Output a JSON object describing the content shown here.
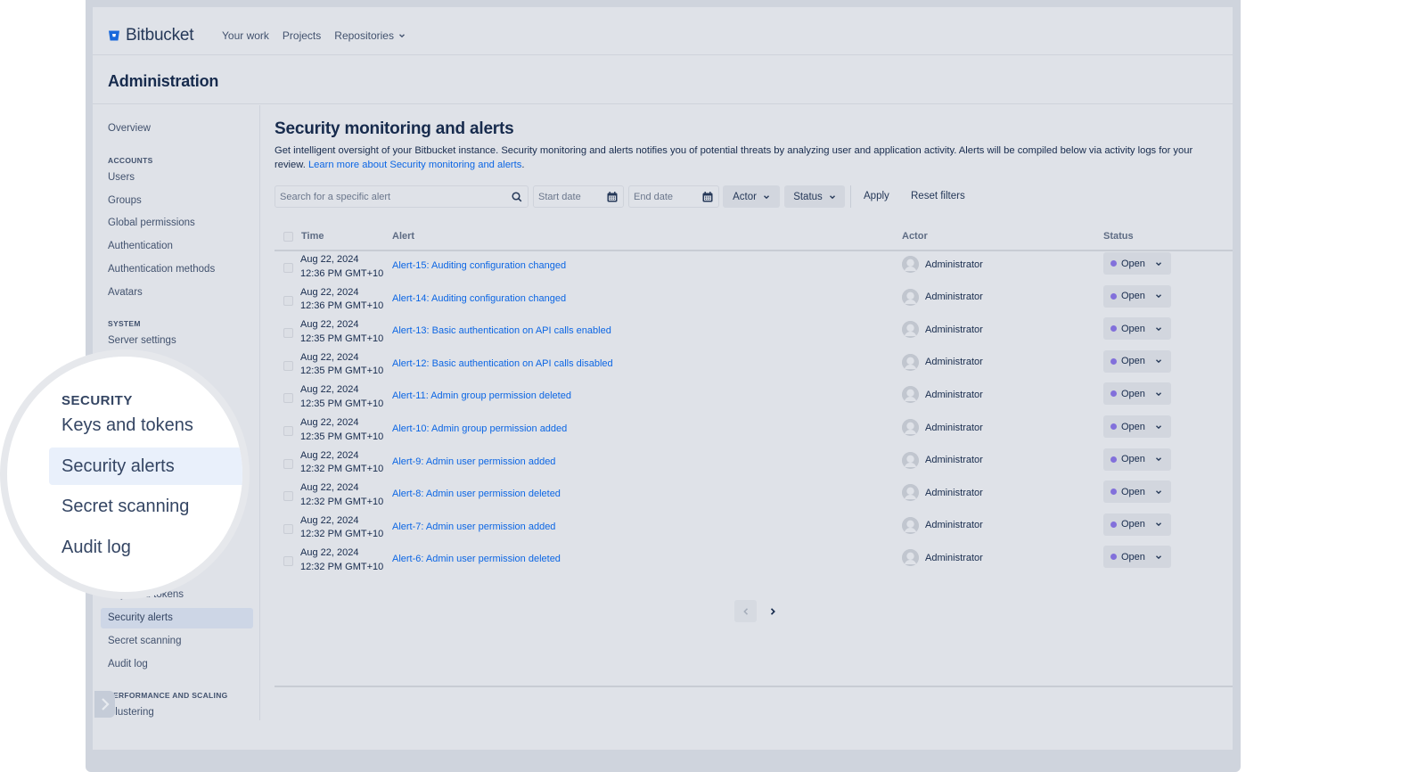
{
  "header": {
    "brand": "Bitbucket",
    "nav": [
      {
        "label": "Your work"
      },
      {
        "label": "Projects"
      },
      {
        "label": "Repositories",
        "has_dropdown": true
      }
    ]
  },
  "admin_title": "Administration",
  "sidebar": {
    "overview": "Overview",
    "sections": {
      "accounts": {
        "heading": "ACCOUNTS",
        "items": [
          "Users",
          "Groups",
          "Global permissions",
          "Authentication",
          "Authentication methods",
          "Avatars"
        ]
      },
      "system": {
        "heading": "SYSTEM",
        "items": [
          "Server settings"
        ]
      },
      "security": {
        "heading": "SECURITY",
        "items": [
          "Keys and tokens",
          "Security alerts",
          "Secret scanning",
          "Audit log"
        ],
        "active": "Security alerts"
      },
      "performance": {
        "heading": "PERFORMANCE AND SCALING",
        "items": [
          "Clustering"
        ]
      }
    }
  },
  "magnifier": {
    "heading": "SECURITY",
    "items": [
      "Keys and tokens",
      "Security alerts",
      "Secret scanning",
      "Audit log"
    ],
    "active": "Security alerts"
  },
  "page": {
    "title": "Security monitoring and alerts",
    "description": "Get intelligent oversight of your Bitbucket instance. Security monitoring and alerts notifies you of potential threats by analyzing user and application activity. Alerts will be compiled below via activity logs for your review.",
    "learn_more": "Learn more about Security monitoring and alerts",
    "learn_more_suffix": "."
  },
  "filters": {
    "search_placeholder": "Search for a specific alert",
    "search_value": "",
    "start_date_placeholder": "Start date",
    "end_date_placeholder": "End date",
    "actor_label": "Actor",
    "status_label": "Status",
    "apply_label": "Apply",
    "reset_label": "Reset filters"
  },
  "table": {
    "columns": {
      "time": "Time",
      "alert": "Alert",
      "actor": "Actor",
      "status": "Status"
    },
    "rows": [
      {
        "date": "Aug 22, 2024",
        "time": "12:36 PM GMT+10",
        "alert": "Alert-15: Auditing configuration changed",
        "actor": "Administrator",
        "status": "Open"
      },
      {
        "date": "Aug 22, 2024",
        "time": "12:36 PM GMT+10",
        "alert": "Alert-14: Auditing configuration changed",
        "actor": "Administrator",
        "status": "Open"
      },
      {
        "date": "Aug 22, 2024",
        "time": "12:35 PM GMT+10",
        "alert": "Alert-13: Basic authentication on API calls enabled",
        "actor": "Administrator",
        "status": "Open"
      },
      {
        "date": "Aug 22, 2024",
        "time": "12:35 PM GMT+10",
        "alert": "Alert-12: Basic authentication on API calls disabled",
        "actor": "Administrator",
        "status": "Open"
      },
      {
        "date": "Aug 22, 2024",
        "time": "12:35 PM GMT+10",
        "alert": "Alert-11: Admin group permission deleted",
        "actor": "Administrator",
        "status": "Open"
      },
      {
        "date": "Aug 22, 2024",
        "time": "12:35 PM GMT+10",
        "alert": "Alert-10: Admin group permission added",
        "actor": "Administrator",
        "status": "Open"
      },
      {
        "date": "Aug 22, 2024",
        "time": "12:32 PM GMT+10",
        "alert": "Alert-9: Admin user permission added",
        "actor": "Administrator",
        "status": "Open"
      },
      {
        "date": "Aug 22, 2024",
        "time": "12:32 PM GMT+10",
        "alert": "Alert-8: Admin user permission deleted",
        "actor": "Administrator",
        "status": "Open"
      },
      {
        "date": "Aug 22, 2024",
        "time": "12:32 PM GMT+10",
        "alert": "Alert-7: Admin user permission added",
        "actor": "Administrator",
        "status": "Open"
      },
      {
        "date": "Aug 22, 2024",
        "time": "12:32 PM GMT+10",
        "alert": "Alert-6: Admin user permission deleted",
        "actor": "Administrator",
        "status": "Open"
      }
    ]
  },
  "pagination": {
    "prev_icon": "chevron-left-icon",
    "next_icon": "chevron-right-icon",
    "prev_disabled": true
  },
  "colors": {
    "brand": "#0c66e4",
    "link": "#0c66e4",
    "status_open_dot": "#8270db",
    "active_nav_bg": "#cdd6e6",
    "magnifier_active_bg": "#e9f0fb"
  }
}
